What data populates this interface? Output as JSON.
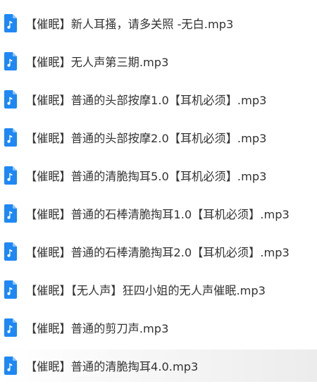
{
  "files": [
    {
      "name": "【催眠】新人耳搔，请多关照 -无白.mp3",
      "icon": "audio-file-icon"
    },
    {
      "name": "【催眠】无人声第三期.mp3",
      "icon": "audio-file-icon"
    },
    {
      "name": "【催眠】普通的头部按摩1.0【耳机必须】.mp3",
      "icon": "audio-file-icon"
    },
    {
      "name": "【催眠】普通的头部按摩2.0【耳机必须】.mp3",
      "icon": "audio-file-icon"
    },
    {
      "name": "【催眠】普通的清脆掏耳5.0【耳机必须】.mp3",
      "icon": "audio-file-icon"
    },
    {
      "name": "【催眠】普通的石棒清脆掏耳1.0【耳机必须】.mp3",
      "icon": "audio-file-icon"
    },
    {
      "name": "【催眠】普通的石棒清脆掏耳2.0【耳机必须】.mp3",
      "icon": "audio-file-icon"
    },
    {
      "name": "【催眠】【无人声】狂四小姐的无人声催眠.mp3",
      "icon": "audio-file-icon"
    },
    {
      "name": "【催眠】普通的剪刀声.mp3",
      "icon": "audio-file-icon"
    },
    {
      "name": "【催眠】普通的清脆掏耳4.0.mp3",
      "icon": "audio-file-icon"
    }
  ],
  "colors": {
    "icon_blue": "#1e88f5",
    "text": "#333333"
  }
}
